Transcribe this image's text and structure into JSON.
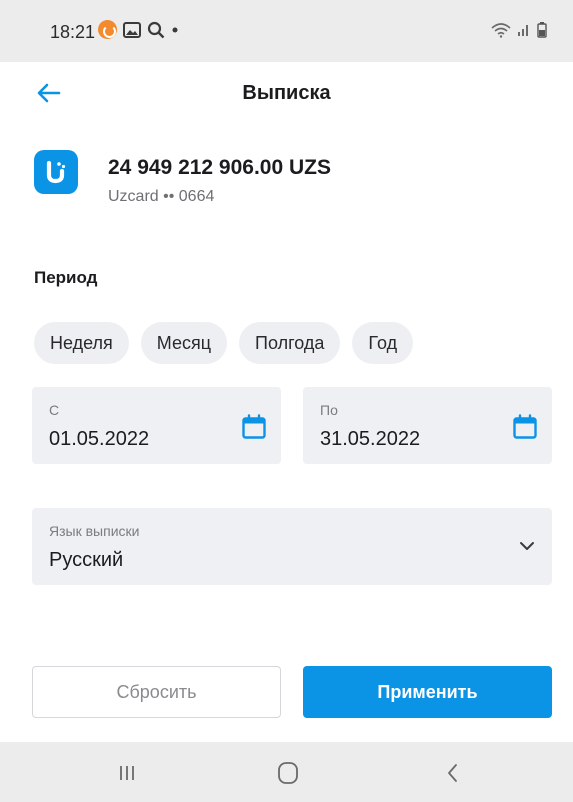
{
  "status_bar": {
    "time": "18:21"
  },
  "header": {
    "title": "Выписка"
  },
  "account": {
    "amount": "24 949 212 906.00 UZS",
    "card_label": "Uzcard •• 0664"
  },
  "period": {
    "label": "Период",
    "chips": [
      "Неделя",
      "Месяц",
      "Полгода",
      "Год"
    ]
  },
  "date_from": {
    "caption": "С",
    "value": "01.05.2022"
  },
  "date_to": {
    "caption": "По",
    "value": "31.05.2022"
  },
  "language": {
    "caption": "Язык выписки",
    "value": "Русский"
  },
  "buttons": {
    "reset": "Сбросить",
    "apply": "Применить"
  },
  "colors": {
    "accent": "#0b93e6",
    "field_bg": "#eef0f3",
    "bar_bg": "#ececec"
  },
  "icons": [
    "back-arrow-icon",
    "card-logo-icon",
    "calendar-icon",
    "chevron-down-icon",
    "recent-apps-icon",
    "home-icon",
    "back-nav-icon"
  ]
}
